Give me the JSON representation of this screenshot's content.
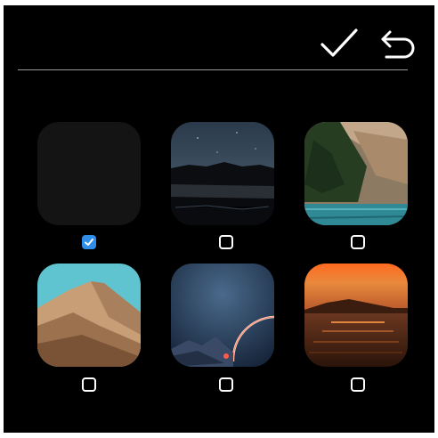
{
  "toolbar": {
    "confirm_icon": "checkmark-icon",
    "back_icon": "undo-arrow-icon"
  },
  "wallpapers": [
    {
      "name": "plain-dark",
      "selected": true
    },
    {
      "name": "night-mountains-lake",
      "selected": false
    },
    {
      "name": "canyon-lake",
      "selected": false
    },
    {
      "name": "desert-dunes",
      "selected": false
    },
    {
      "name": "planet-arc-night",
      "selected": false
    },
    {
      "name": "sunset-sea",
      "selected": false
    }
  ],
  "colors": {
    "background": "#000000",
    "checkbox_selected": "#2f8ee8",
    "checkbox_border": "#ffffff",
    "divider": "#9a9a9a"
  }
}
